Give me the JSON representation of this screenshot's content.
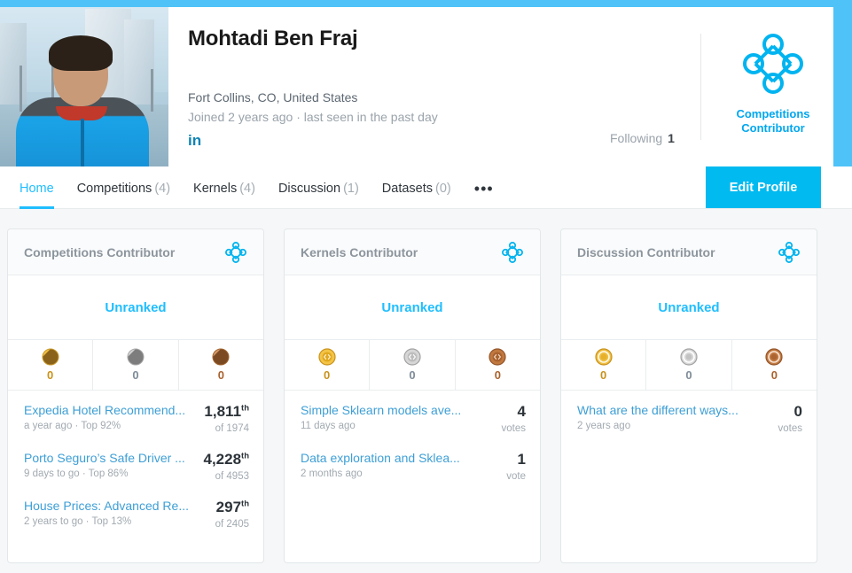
{
  "theme": {
    "accent": "#20beff",
    "band": "#4fc3f7",
    "button": "#00baf0",
    "link": "#3e9fd6",
    "gold": "#e8a317",
    "silver": "#9b9b9b",
    "bronze": "#a9622f"
  },
  "profile": {
    "name": "Mohtadi Ben Fraj",
    "location": "Fort Collins, CO, United States",
    "joined": "Joined 2 years ago · last seen in the past day",
    "linkedin_label": "in",
    "linkedin_icon": "linkedin-icon",
    "avatar_icon": "profile-photo",
    "following_label": "Following",
    "following_count": "1",
    "badge_icon": "competitions-contributor-badge-icon",
    "badge_line1": "Competitions",
    "badge_line2": "Contributor"
  },
  "nav": {
    "tabs": [
      {
        "label": "Home",
        "count": "",
        "active": true
      },
      {
        "label": "Competitions",
        "count": "(4)",
        "active": false
      },
      {
        "label": "Kernels",
        "count": "(4)",
        "active": false
      },
      {
        "label": "Discussion",
        "count": "(1)",
        "active": false
      },
      {
        "label": "Datasets",
        "count": "(0)",
        "active": false
      }
    ],
    "more_label": "•••",
    "edit_profile_label": "Edit Profile"
  },
  "cards": [
    {
      "title": "Competitions Contributor",
      "badge_icon": "competitions-badge-icon",
      "rank": "Unranked",
      "medals": [
        {
          "tier": "gold",
          "type": "competition-medal",
          "count": "0"
        },
        {
          "tier": "silver",
          "type": "competition-medal",
          "count": "0"
        },
        {
          "tier": "bronze",
          "type": "competition-medal",
          "count": "0"
        }
      ],
      "entries": [
        {
          "title": "Expedia Hotel Recommend...",
          "sub": "a year ago · Top 92%",
          "value": "1,811",
          "suffix": "th",
          "meta": "of 1974",
          "kind": "rank"
        },
        {
          "title": "Porto Seguro’s Safe Driver ...",
          "sub": "9 days to go · Top 86%",
          "value": "4,228",
          "suffix": "th",
          "meta": "of 4953",
          "kind": "rank"
        },
        {
          "title": "House Prices: Advanced Re...",
          "sub": "2 years to go · Top 13%",
          "value": "297",
          "suffix": "th",
          "meta": "of 2405",
          "kind": "rank"
        }
      ]
    },
    {
      "title": "Kernels Contributor",
      "badge_icon": "kernels-badge-icon",
      "rank": "Unranked",
      "medals": [
        {
          "tier": "gold",
          "type": "kernel-medal",
          "count": "0"
        },
        {
          "tier": "silver",
          "type": "kernel-medal",
          "count": "0"
        },
        {
          "tier": "bronze",
          "type": "kernel-medal",
          "count": "0"
        }
      ],
      "entries": [
        {
          "title": "Simple Sklearn models ave...",
          "sub": "11 days ago",
          "value": "4",
          "suffix": "",
          "meta": "votes",
          "kind": "vote"
        },
        {
          "title": "Data exploration and Sklea...",
          "sub": "2 months ago",
          "value": "1",
          "suffix": "",
          "meta": "vote",
          "kind": "vote"
        }
      ]
    },
    {
      "title": "Discussion Contributor",
      "badge_icon": "discussion-badge-icon",
      "rank": "Unranked",
      "medals": [
        {
          "tier": "gold",
          "type": "discussion-medal",
          "count": "0"
        },
        {
          "tier": "silver",
          "type": "discussion-medal",
          "count": "0"
        },
        {
          "tier": "bronze",
          "type": "discussion-medal",
          "count": "0"
        }
      ],
      "entries": [
        {
          "title": "What are the different ways...",
          "sub": "2 years ago",
          "value": "0",
          "suffix": "",
          "meta": "votes",
          "kind": "vote"
        }
      ]
    }
  ]
}
